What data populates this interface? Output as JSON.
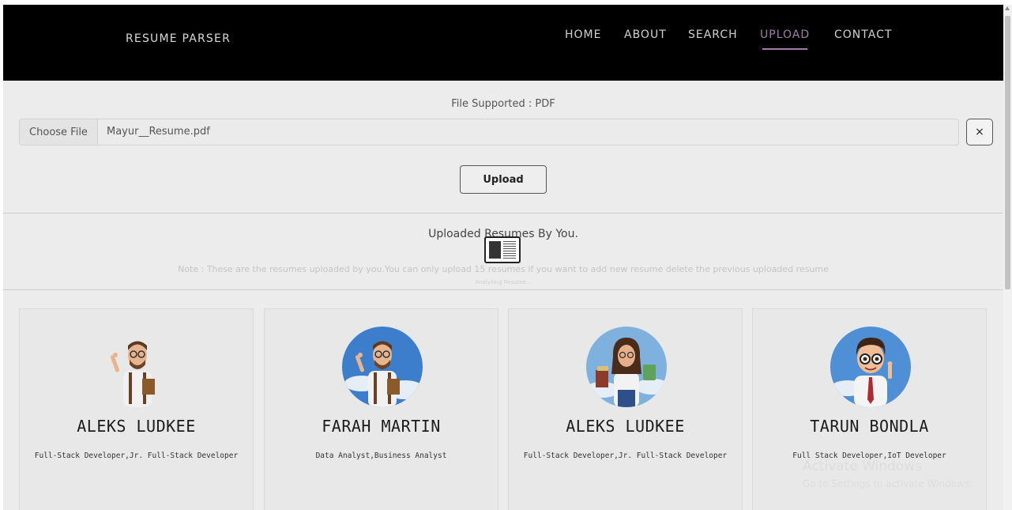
{
  "navbar": {
    "brand": "RESUME PARSER",
    "links": [
      {
        "label": "HOME",
        "active": false
      },
      {
        "label": "ABOUT",
        "active": false
      },
      {
        "label": "SEARCH",
        "active": false
      },
      {
        "label": "UPLOAD",
        "active": true
      },
      {
        "label": "CONTACT",
        "active": false
      }
    ],
    "active_color": "#a07ca7"
  },
  "upload": {
    "supported_text": "File Supported : PDF",
    "choose_file_label": "Choose File",
    "file_name": "Mayur__Resume.pdf",
    "clear_label": "×",
    "upload_label": "Upload"
  },
  "resumes": {
    "title": "Uploaded Resumes By You.",
    "note": "Note : These are the resumes uploaded by you.You can only upload 15 resumes if you want to add new resume delete the previous uploaded resume",
    "loader_text": "Analyzing Resume..."
  },
  "cards": [
    {
      "name": "ALEKS LUDKEE",
      "roles": "Full-Stack Developer,Jr. Full-Stack Developer",
      "avatar": "man-with-beard-avatar-icon"
    },
    {
      "name": "FARAH MARTIN",
      "roles": "Data Analyst,Business Analyst",
      "avatar": "man-with-beard-sky-avatar-icon"
    },
    {
      "name": "ALEKS LUDKEE",
      "roles": "Full-Stack Developer,Jr. Full-Stack Developer",
      "avatar": "woman-with-books-avatar-icon"
    },
    {
      "name": "TARUN BONDLA",
      "roles": "Full Stack Developer,IoT Developer",
      "avatar": "man-with-glasses-avatar-icon"
    }
  ],
  "watermark": {
    "title": "Activate Windows",
    "subtitle": "Go to Settings to activate Windows."
  }
}
